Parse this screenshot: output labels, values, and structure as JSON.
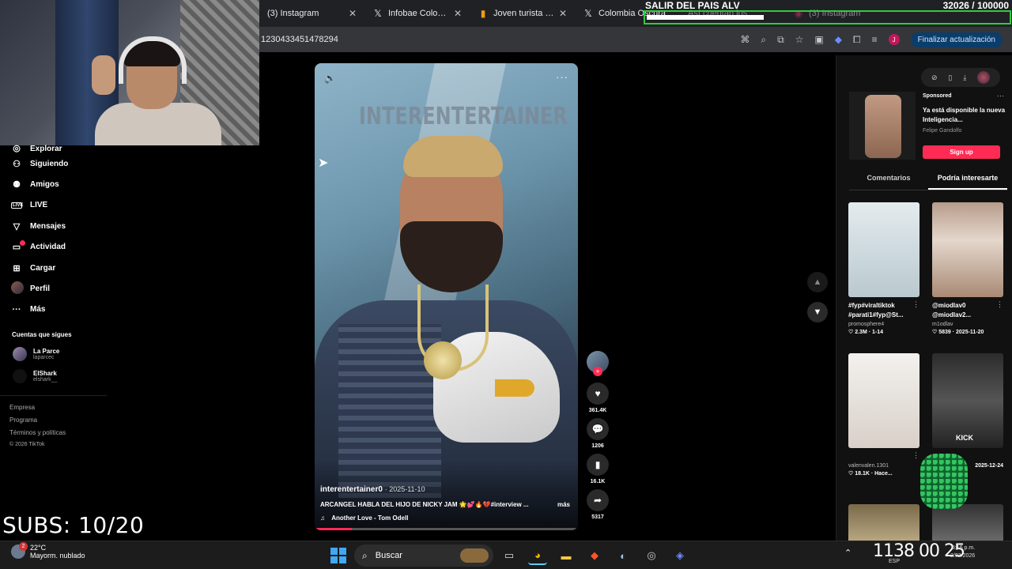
{
  "browser": {
    "tabs": [
      {
        "label": "(3) Instagram",
        "icon": "instagram-icon"
      },
      {
        "label": "Infobae Colombia",
        "icon": "x-icon"
      },
      {
        "label": "Joven turista fallec",
        "icon": "infobae-icon"
      },
      {
        "label": "Colombia Oscura",
        "icon": "x-icon"
      },
      {
        "label": "Así cuentan los",
        "icon": "youtube-icon"
      },
      {
        "label": "(3) Instagram",
        "icon": "instagram-icon"
      }
    ],
    "url": "1230433451478294",
    "profile_initial": "J",
    "update_button": "Finalizar actualización"
  },
  "stream_overlay": {
    "title": "SALIR DEL PAIS ALV",
    "goal_counter": "32026 / 100000",
    "goal_progress": 0.32,
    "subs": "SUBS: 10/20"
  },
  "sidebar": {
    "items": [
      {
        "label": "Explorar",
        "icon": "compass-icon"
      },
      {
        "label": "Siguiendo",
        "icon": "user-follow-icon"
      },
      {
        "label": "Amigos",
        "icon": "friends-icon"
      },
      {
        "label": "LIVE",
        "icon": "live-icon"
      },
      {
        "label": "Mensajes",
        "icon": "send-icon"
      },
      {
        "label": "Actividad",
        "icon": "activity-icon",
        "badge": true
      },
      {
        "label": "Cargar",
        "icon": "upload-icon"
      },
      {
        "label": "Perfil",
        "icon": "profile-avatar"
      },
      {
        "label": "Más",
        "icon": "more-icon"
      }
    ],
    "following_title": "Cuentas que sigues",
    "following": [
      {
        "name": "La Parce",
        "handle": "laparcec"
      },
      {
        "name": "ElShark",
        "handle": "elshark__"
      }
    ],
    "footer": [
      "Empresa",
      "Programa",
      "Términos y políticas"
    ],
    "copyright": "© 2026 TikTok"
  },
  "video": {
    "overlay_title": "INTERENTERTAINER",
    "author": "interentertainer0",
    "date": "· 2025-11-10",
    "caption": "ARCANGEL HABLA DEL HIJO DE NICKY JAM 🌟💕🔥💔#interview ...",
    "more": "más",
    "music": "Another Love - Tom Odell",
    "progress": 0.14
  },
  "actions": {
    "likes": "361.4K",
    "comments": "1206",
    "saves": "16.1K",
    "shares": "5317"
  },
  "right_panel": {
    "ad": {
      "sponsored": "Sponsored",
      "title": "Ya está disponible la nueva Inteligencia...",
      "author": "Felipe Gandolfo",
      "button": "Sign up"
    },
    "tabs": [
      "Comentarios",
      "Podría interesarte"
    ],
    "cards": [
      {
        "title": "#fyp#viraltiktok #parati1#fyp@St...",
        "author": "promosphere4",
        "stats": "♡ 2.3M · 1-14",
        "thumb": "t1"
      },
      {
        "title": "@miodlav0 @miodlav2...",
        "author": "m1odlav",
        "stats": "♡ 5839 · 2025-11-20",
        "thumb": "t2"
      },
      {
        "title": "",
        "author": "valenvalen.1301",
        "stats": "♡ 18.1K · Hace...",
        "thumb": "t3"
      },
      {
        "title": "",
        "author": "",
        "stats": "2025-12-24",
        "thumb": "t4",
        "overlay": "KICK"
      },
      {
        "title": "",
        "author": "",
        "stats": "",
        "thumb": "t5"
      },
      {
        "title": "",
        "author": "",
        "stats": "",
        "thumb": "t6"
      }
    ]
  },
  "taskbar": {
    "temperature": "22°C",
    "weather": "Mayorm. nublado",
    "weather_badge": "2",
    "search": "Buscar",
    "clock_big": "1138  00  25",
    "clock_time": "5:16 p.m.",
    "clock_date": "2/02/2026",
    "lang": "ESP"
  }
}
